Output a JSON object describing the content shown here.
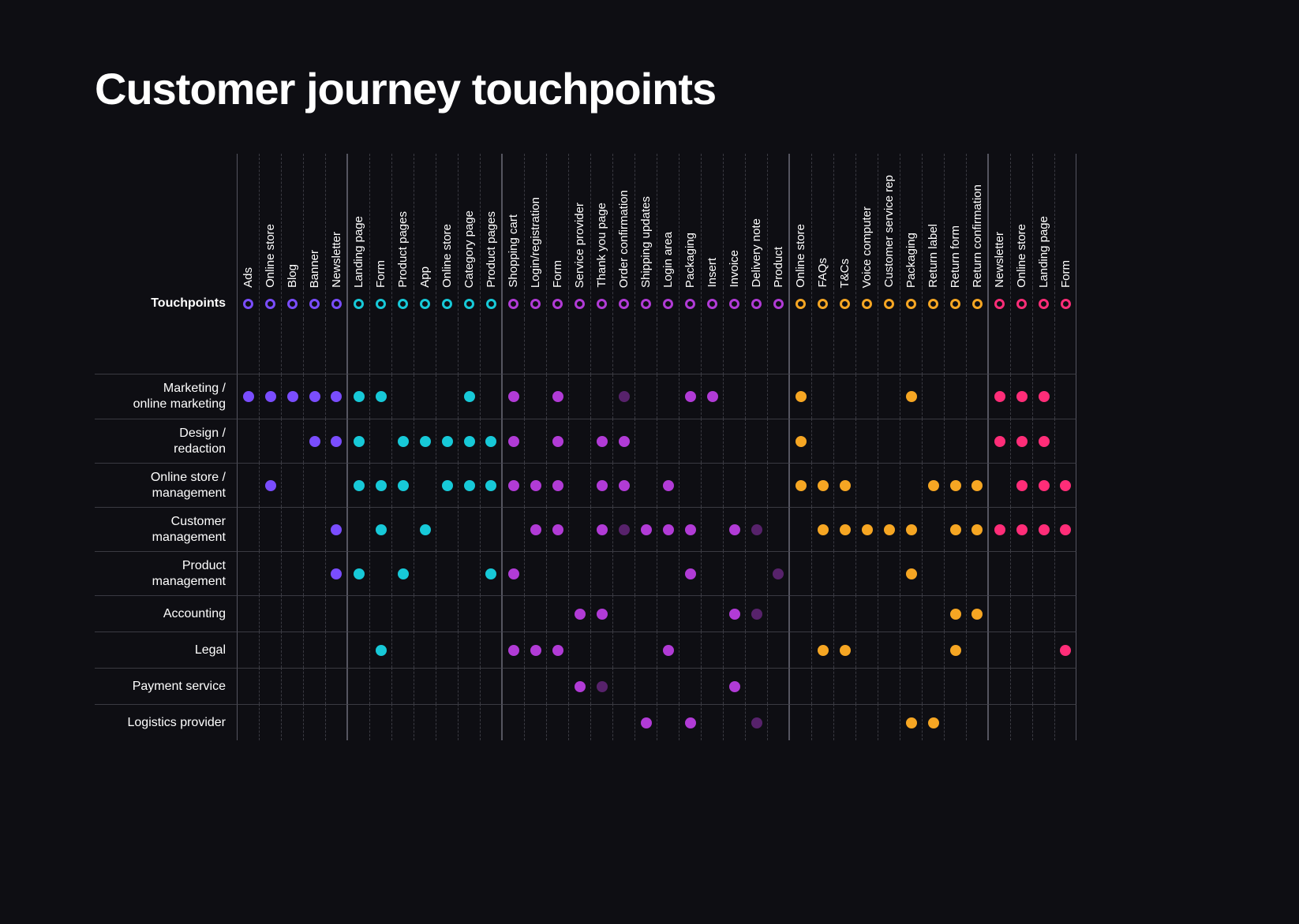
{
  "title": "Customer journey touchpoints",
  "row_header_label": "Touchpoints",
  "chart_data": {
    "type": "heatmap",
    "title": "Customer journey touchpoints",
    "column_groups": [
      {
        "color": "#7a4dff",
        "columns": [
          "Ads",
          "Online store",
          "Blog",
          "Banner",
          "Newsletter"
        ]
      },
      {
        "color": "#17c9d8",
        "columns": [
          "Landing page",
          "Form",
          "Product pages",
          "App",
          "Online store",
          "Category page",
          "Product pages"
        ]
      },
      {
        "color": "#b13bd6",
        "columns": [
          "Shopping cart",
          "Login/registration",
          "Form",
          "Service provider",
          "Thank you page",
          "Order confirmation",
          "Shipping updates",
          "Login area",
          "Packaging",
          "Insert",
          "Invoice",
          "Delivery note",
          "Product"
        ]
      },
      {
        "color": "#f6a623",
        "columns": [
          "Online store",
          "FAQs",
          "T&Cs",
          "Voice computer",
          "Customer service rep",
          "Packaging",
          "Return label",
          "Return form",
          "Return confirmation"
        ]
      },
      {
        "color": "#ff2d78",
        "columns": [
          "Newsletter",
          "Online store",
          "Landing page",
          "Form"
        ]
      }
    ],
    "rows": [
      {
        "label": "Marketing /\nonline marketing",
        "short": false,
        "cells": [
          1,
          1,
          1,
          1,
          1,
          1,
          1,
          0,
          0,
          0,
          1,
          0,
          1,
          0,
          1,
          0,
          0,
          2,
          0,
          0,
          1,
          1,
          0,
          0,
          0,
          1,
          0,
          0,
          0,
          0,
          1,
          0,
          0,
          0,
          1,
          1,
          1,
          0
        ]
      },
      {
        "label": "Design /\nredaction",
        "short": false,
        "cells": [
          0,
          0,
          0,
          1,
          1,
          1,
          0,
          1,
          1,
          1,
          1,
          1,
          1,
          0,
          1,
          0,
          1,
          1,
          0,
          0,
          0,
          0,
          0,
          0,
          0,
          1,
          0,
          0,
          0,
          0,
          0,
          0,
          0,
          0,
          1,
          1,
          1,
          0
        ]
      },
      {
        "label": "Online store /\nmanagement",
        "short": false,
        "cells": [
          0,
          1,
          0,
          0,
          0,
          1,
          1,
          1,
          0,
          1,
          1,
          1,
          1,
          1,
          1,
          0,
          1,
          1,
          0,
          1,
          0,
          0,
          0,
          0,
          0,
          1,
          1,
          1,
          0,
          0,
          0,
          1,
          1,
          1,
          0,
          1,
          1,
          1
        ]
      },
      {
        "label": "Customer\nmanagement",
        "short": false,
        "cells": [
          0,
          0,
          0,
          0,
          1,
          0,
          1,
          0,
          1,
          0,
          0,
          0,
          0,
          1,
          1,
          0,
          1,
          2,
          1,
          1,
          1,
          0,
          1,
          2,
          0,
          0,
          1,
          1,
          1,
          1,
          1,
          0,
          1,
          1,
          1,
          1,
          1,
          1
        ]
      },
      {
        "label": "Product\nmanagement",
        "short": false,
        "cells": [
          0,
          0,
          0,
          0,
          1,
          1,
          0,
          1,
          0,
          0,
          0,
          1,
          1,
          0,
          0,
          0,
          0,
          0,
          0,
          0,
          1,
          0,
          0,
          0,
          2,
          0,
          0,
          0,
          0,
          0,
          1,
          0,
          0,
          0,
          0,
          0,
          0,
          0
        ]
      },
      {
        "label": "Accounting",
        "short": true,
        "cells": [
          0,
          0,
          0,
          0,
          0,
          0,
          0,
          0,
          0,
          0,
          0,
          0,
          0,
          0,
          0,
          1,
          1,
          0,
          0,
          0,
          0,
          0,
          1,
          2,
          0,
          0,
          0,
          0,
          0,
          0,
          0,
          0,
          1,
          1,
          0,
          0,
          0,
          0
        ]
      },
      {
        "label": "Legal",
        "short": true,
        "cells": [
          0,
          0,
          0,
          0,
          0,
          0,
          1,
          0,
          0,
          0,
          0,
          0,
          1,
          1,
          1,
          0,
          0,
          0,
          0,
          1,
          0,
          0,
          0,
          0,
          0,
          0,
          1,
          1,
          0,
          0,
          0,
          0,
          1,
          0,
          0,
          0,
          0,
          1
        ]
      },
      {
        "label": "Payment service",
        "short": true,
        "cells": [
          0,
          0,
          0,
          0,
          0,
          0,
          0,
          0,
          0,
          0,
          0,
          0,
          0,
          0,
          0,
          1,
          2,
          0,
          0,
          0,
          0,
          0,
          1,
          0,
          0,
          0,
          0,
          0,
          0,
          0,
          0,
          0,
          0,
          0,
          0,
          0,
          0,
          0
        ]
      },
      {
        "label": "Logistics provider",
        "short": true,
        "cells": [
          0,
          0,
          0,
          0,
          0,
          0,
          0,
          0,
          0,
          0,
          0,
          0,
          0,
          0,
          0,
          0,
          0,
          0,
          1,
          0,
          1,
          0,
          0,
          2,
          0,
          0,
          0,
          0,
          0,
          0,
          1,
          1,
          0,
          0,
          0,
          0,
          0,
          0
        ]
      }
    ]
  }
}
